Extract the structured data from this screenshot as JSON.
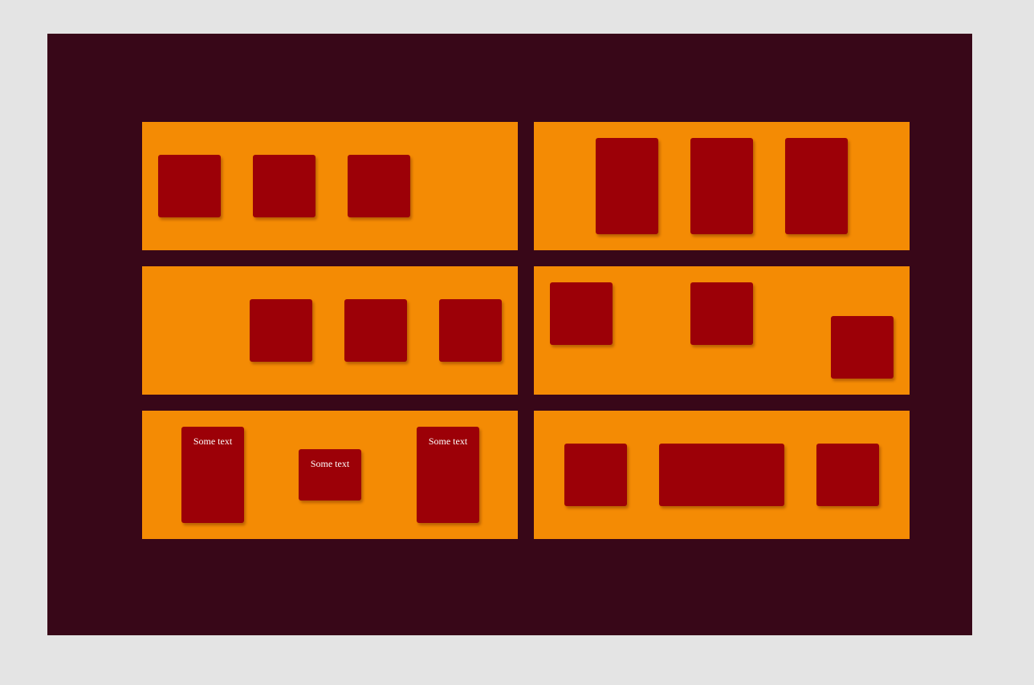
{
  "colors": {
    "page_background": "#e4e4e4",
    "frame_background": "#380718",
    "panel_background": "#f48b04",
    "box_background": "#9c0007",
    "box_text": "#ffffff"
  },
  "panels": {
    "bottom_left": {
      "boxes": [
        {
          "label": "Some text"
        },
        {
          "label": "Some text"
        },
        {
          "label": "Some text"
        }
      ]
    }
  }
}
